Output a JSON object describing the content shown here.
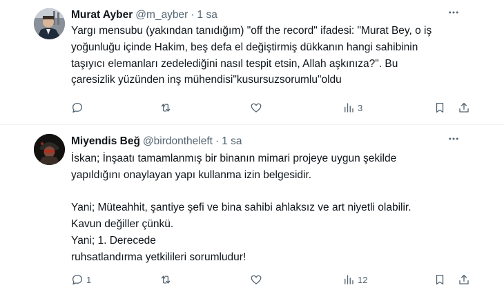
{
  "tweets": [
    {
      "author": {
        "name": "Murat Ayber",
        "handle": "@m_ayber",
        "time": "1 sa"
      },
      "text": [
        "Yargı mensubu (yakından tanıdığım) \"off the record\" ifadesi: \"Murat Bey, o iş",
        "yoğunluğu içinde Hakim, beş defa el değiştirmiş dükkanın hangi sahibinin",
        "taşıyıcı elemanları zedelediğini nasıl tespit etsin, Allah aşkınıza?\". Bu",
        "çaresizlik yüzünden inş mühendisi\"kusursuzsorumlu\"oldu"
      ],
      "actions": {
        "reply_count": "",
        "retweet_count": "",
        "like_count": "",
        "view_count": "3"
      }
    },
    {
      "author": {
        "name": "Miyendis Beğ",
        "handle": "@birdontheleft",
        "time": "1 sa"
      },
      "text": [
        "İskan; İnşaatı tamamlanmış bir binanın mimari projeye uygun şekilde",
        "yapıldığını onaylayan yapı kullanma izin belgesidir.",
        "",
        "Yani; Müteahhit, şantiye şefi ve bina sahibi ahlaksız ve art niyetli olabilir.",
        "Kavun değiller çünkü.",
        "Yani; 1. Derecede",
        "ruhsatlandırma yetkilileri sorumludur!"
      ],
      "actions": {
        "reply_count": "1",
        "retweet_count": "",
        "like_count": "",
        "view_count": "12"
      }
    }
  ],
  "ui": {
    "separator": "·",
    "more_icon": "more-dots-icon"
  },
  "colors": {
    "text": "#0f1419",
    "muted": "#536471",
    "border": "#eff3f4"
  }
}
